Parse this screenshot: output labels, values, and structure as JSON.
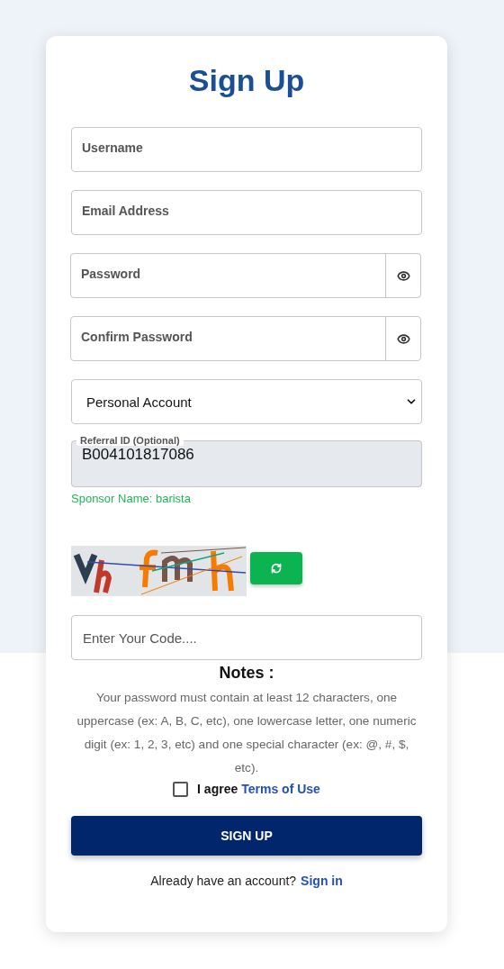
{
  "title": "Sign Up",
  "fields": [
    {
      "kind": "text",
      "placeholder": "Username"
    },
    {
      "kind": "text",
      "placeholder": "Email Address"
    },
    {
      "kind": "password",
      "placeholder": "Password"
    },
    {
      "kind": "password",
      "placeholder": "Confirm Password"
    },
    {
      "kind": "select",
      "value": "Personal Account"
    },
    {
      "kind": "referral",
      "label": "Referral ID (Optional)",
      "value": "B004101817086",
      "note": "Sponsor Name: barista"
    }
  ],
  "code_field": {
    "placeholder": "Enter Your Code...."
  },
  "notes": {
    "heading": "Notes :",
    "text": "Your password must contain at least 12 characters, one uppercase (ex: A, B, C, etc), one lowercase letter, one numeric digit (ex: 1, 2, 3, etc) and one special character (ex: @, #, $, etc)."
  },
  "agree": {
    "checked": false,
    "label": "I agree",
    "link": "Terms of Use"
  },
  "submit": "SIGN UP",
  "signin": {
    "text": "Already have an account?",
    "link": "Sign in"
  }
}
